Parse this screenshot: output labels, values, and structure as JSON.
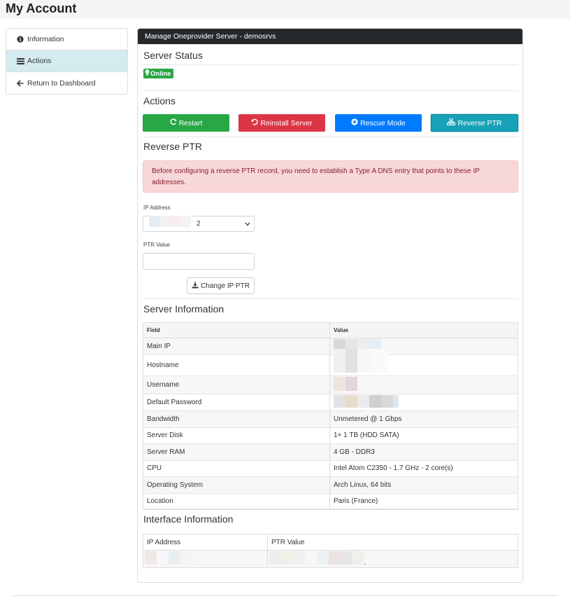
{
  "page": {
    "title": "My Account"
  },
  "sidebar": {
    "items": [
      {
        "label": "Information",
        "icon": "info-circle-icon"
      },
      {
        "label": "Actions",
        "icon": "list-icon",
        "active": true
      },
      {
        "label": "Return to Dashboard",
        "icon": "arrow-left-icon"
      }
    ]
  },
  "panel": {
    "header": "Manage Oneprovider Server - demosrvs",
    "server_status": {
      "title": "Server Status",
      "badge": "Online",
      "badge_icon": "lightbulb-icon"
    },
    "actions": {
      "title": "Actions",
      "buttons": [
        {
          "label": "Restart",
          "icon": "refresh-icon",
          "color": "#28a745"
        },
        {
          "label": "Reinstall Server",
          "icon": "undo-icon",
          "color": "#dc3545"
        },
        {
          "label": "Rescue Mode",
          "icon": "times-circle-icon",
          "color": "#007bff"
        },
        {
          "label": "Reverse PTR",
          "icon": "sitemap-icon",
          "color": "#17a2b8"
        }
      ]
    },
    "reverse_ptr": {
      "title": "Reverse PTR",
      "alert": "Before configuring a reverse PTR record, you need to establish a Type A DNS entry that points to these IP addresses.",
      "ip_label": "IP Address",
      "ip_selected_suffix": "2",
      "ptr_label": "PTR Value",
      "ptr_value": "",
      "change_button": "Change IP PTR"
    },
    "server_info": {
      "title": "Server Information",
      "headers": [
        "Field",
        "Value"
      ],
      "rows": [
        {
          "field": "Main IP",
          "value": ""
        },
        {
          "field": "Hostname",
          "value": ""
        },
        {
          "field": "Username",
          "value": ""
        },
        {
          "field": "Default Password",
          "value": ""
        },
        {
          "field": "Bandwidth",
          "value": "Unmetered @ 1 Gbps"
        },
        {
          "field": "Server Disk",
          "value": "1× 1 TB (HDD SATA)"
        },
        {
          "field": "Server RAM",
          "value": "4 GB - DDR3"
        },
        {
          "field": "CPU",
          "value": "Intel Atom C2350 - 1.7 GHz - 2 core(s)"
        },
        {
          "field": "Operating System",
          "value": "Arch Linux, 64 bits"
        },
        {
          "field": "Location",
          "value": "Paris (France)"
        }
      ]
    },
    "interface_info": {
      "title": "Interface Information",
      "headers": [
        "IP Address",
        "PTR Value"
      ],
      "row_suffix": "."
    }
  },
  "colors": {
    "header_bg": "#26292c",
    "active_sidebar": "#d4ebf0",
    "online_green": "#28a745",
    "alert_bg": "#f8d7da"
  }
}
